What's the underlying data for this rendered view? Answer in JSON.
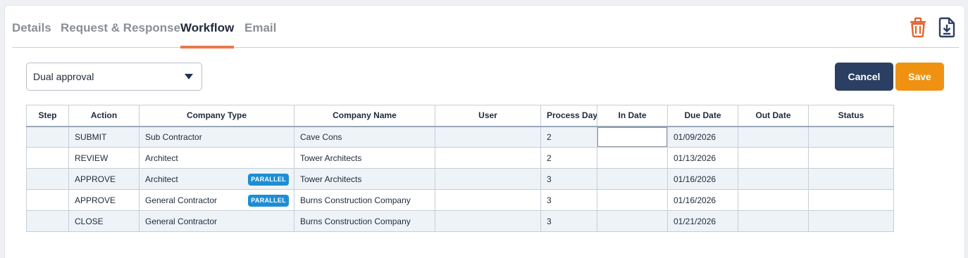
{
  "tabs": [
    "Details",
    "Request & Response",
    "Workflow",
    "Email"
  ],
  "active_tab": "Workflow",
  "icons": {
    "delete": "trash-icon",
    "download": "file-download-icon",
    "dropdown": "caret-down-icon"
  },
  "colors": {
    "accent": "#e8794a",
    "cancel": "#2b3f63",
    "save": "#ef9212",
    "badge": "#1d8ed4",
    "trash": "#e0642e"
  },
  "workflow_select": {
    "value": "Dual approval"
  },
  "buttons": {
    "cancel": "Cancel",
    "save": "Save"
  },
  "table": {
    "headers": [
      "Step",
      "Action",
      "Company Type",
      "Company Name",
      "User",
      "Process Days",
      "In Date",
      "Due Date",
      "Out Date",
      "Status"
    ],
    "rows": [
      {
        "step": "",
        "action": "SUBMIT",
        "company_type": "Sub Contractor",
        "badge": "",
        "company_name": "Cave Cons",
        "user": "",
        "process_days": "2",
        "in_date": "",
        "due_date": "01/09/2026",
        "out_date": "",
        "status": ""
      },
      {
        "step": "",
        "action": "REVIEW",
        "company_type": "Architect",
        "badge": "",
        "company_name": "Tower Architects",
        "user": "",
        "process_days": "2",
        "in_date": "",
        "due_date": "01/13/2026",
        "out_date": "",
        "status": ""
      },
      {
        "step": "",
        "action": "APPROVE",
        "company_type": "Architect",
        "badge": "PARALLEL",
        "company_name": "Tower Architects",
        "user": "",
        "process_days": "3",
        "in_date": "",
        "due_date": "01/16/2026",
        "out_date": "",
        "status": ""
      },
      {
        "step": "",
        "action": "APPROVE",
        "company_type": "General Contractor",
        "badge": "PARALLEL",
        "company_name": "Burns Construction Company",
        "user": "",
        "process_days": "3",
        "in_date": "",
        "due_date": "01/16/2026",
        "out_date": "",
        "status": ""
      },
      {
        "step": "",
        "action": "CLOSE",
        "company_type": "General Contractor",
        "badge": "",
        "company_name": "Burns Construction Company",
        "user": "",
        "process_days": "3",
        "in_date": "",
        "due_date": "01/21/2026",
        "out_date": "",
        "status": ""
      }
    ]
  }
}
